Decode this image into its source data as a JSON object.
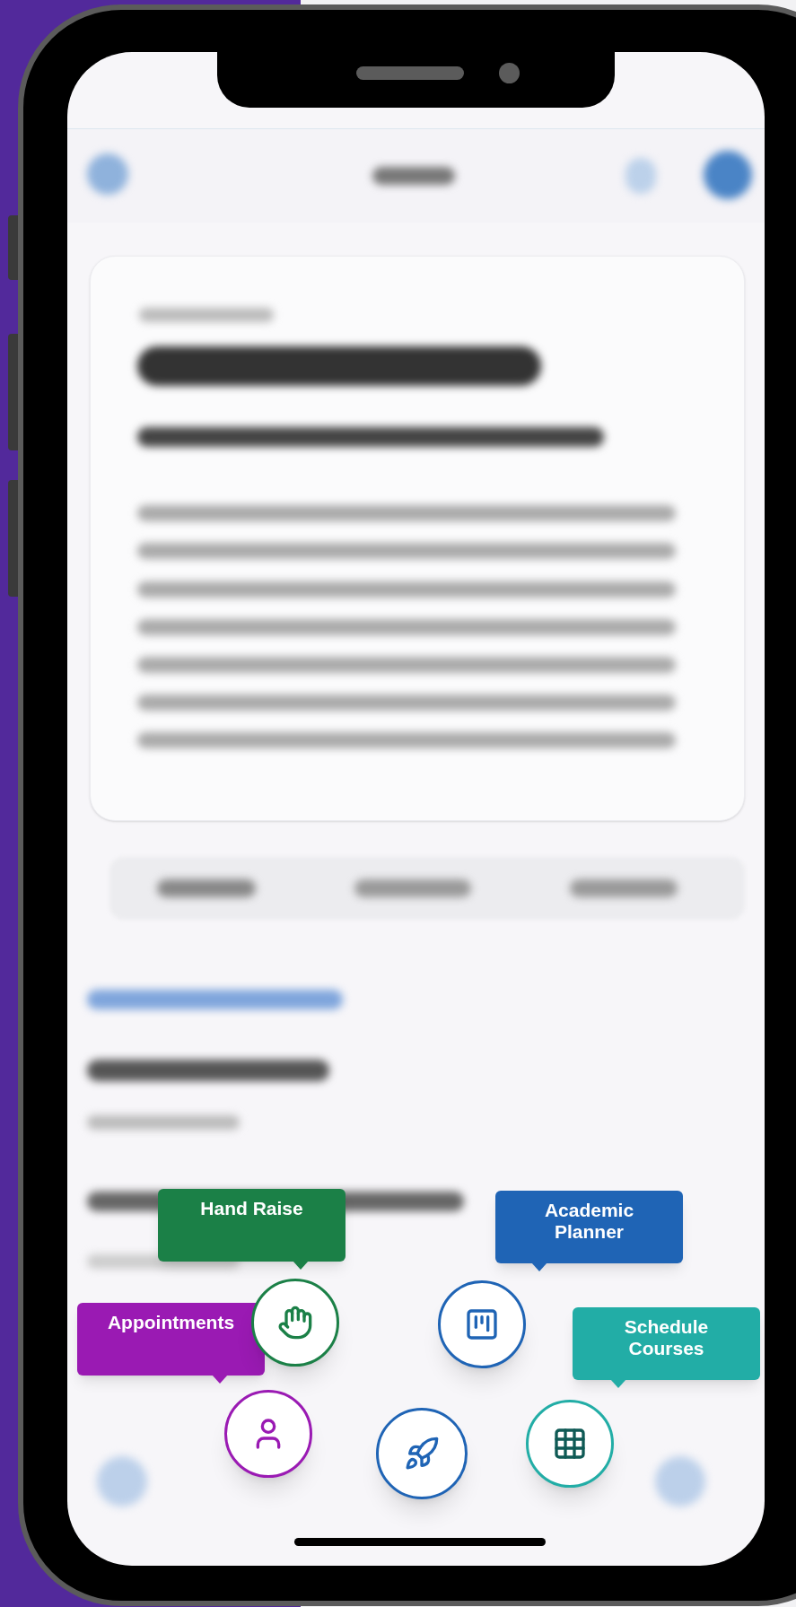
{
  "fab_menu": {
    "actions": [
      {
        "label": "Hand Raise",
        "color": "#1b8047",
        "kind": "hand"
      },
      {
        "label": "Academic Planner",
        "color": "#1f64b5",
        "kind": "planner"
      },
      {
        "label": "Appointments",
        "color": "#9a1ab3",
        "kind": "person"
      },
      {
        "label": "Schedule Courses",
        "color": "#22ada6",
        "kind": "grid"
      }
    ]
  }
}
